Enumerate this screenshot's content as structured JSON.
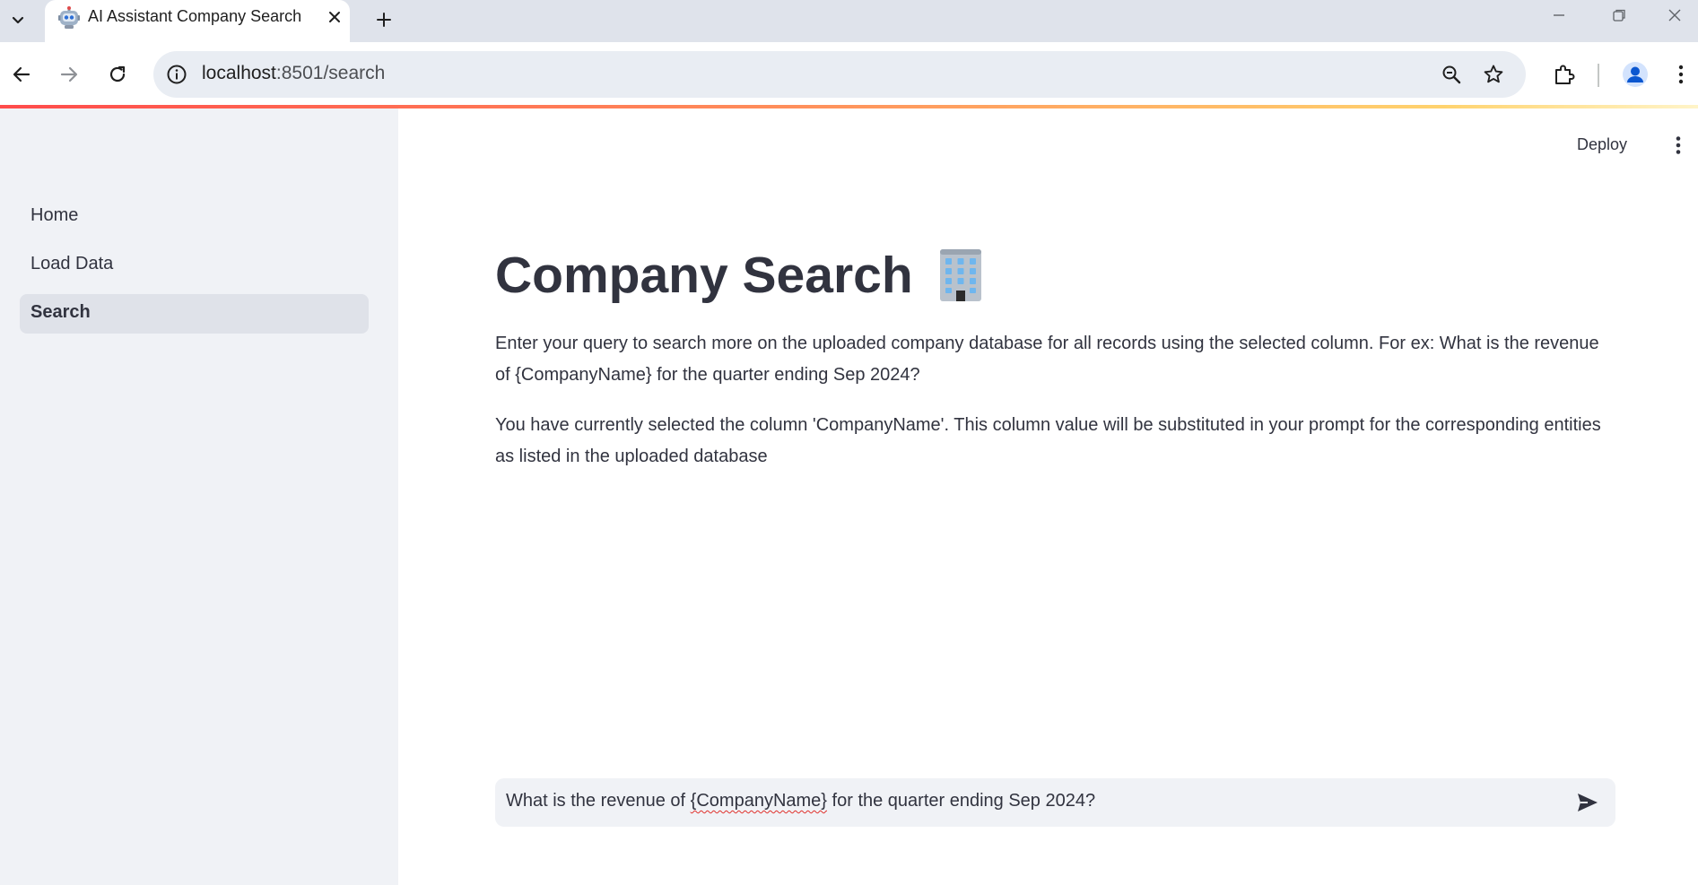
{
  "browser": {
    "tab_title": "AI Assistant Company Search",
    "url_host": "localhost",
    "url_rest": ":8501/search"
  },
  "sidebar": {
    "items": [
      {
        "label": "Home"
      },
      {
        "label": "Load Data"
      },
      {
        "label": "Search"
      }
    ]
  },
  "header": {
    "deploy_label": "Deploy"
  },
  "main": {
    "title": "Company Search",
    "description": "Enter your query to search more on the uploaded company database for all records using the selected column. For ex: What is the revenue of {CompanyName} for the quarter ending Sep 2024?",
    "selected_column_note": "You have currently selected the column 'CompanyName'. This column value will be substituted in your prompt for the corresponding entities as listed in the uploaded database"
  },
  "chat_input": {
    "prefix": "What is the revenue of ",
    "placeholder_token": "{CompanyName}",
    "suffix": " for the quarter ending Sep 2024?"
  },
  "colors": {
    "sidebar_bg": "#f0f2f6",
    "text": "#31333f",
    "active_item_bg": "#dfe2e9",
    "loadbar_start": "#ff4b4b",
    "loadbar_end": "#fff4c8"
  }
}
